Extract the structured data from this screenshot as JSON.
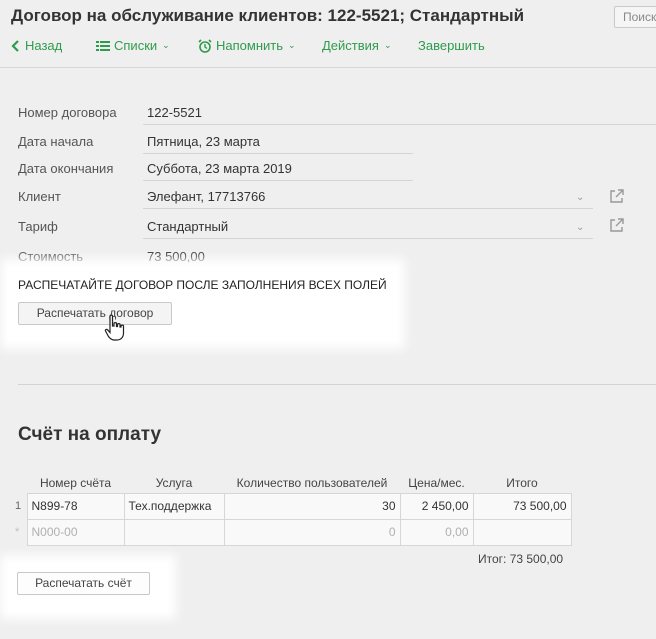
{
  "header": {
    "title": "Договор на обслуживание клиентов: 122-5521; Стандартный",
    "search_label": "Поиск"
  },
  "toolbar": {
    "back": "Назад",
    "lists": "Списки",
    "remind": "Напомнить",
    "actions": "Действия",
    "finish": "Завершить",
    "accent_color": "#2e9c4c"
  },
  "form": {
    "contract_number": {
      "label": "Номер договора",
      "value": "122-5521"
    },
    "start_date": {
      "label": "Дата начала",
      "value": "Пятница, 23 марта"
    },
    "end_date": {
      "label": "Дата окончания",
      "value": "Суббота, 23 марта 2019"
    },
    "client": {
      "label": "Клиент",
      "value": "Элефант, 17713766"
    },
    "tariff": {
      "label": "Тариф",
      "value": "Стандартный"
    },
    "cost": {
      "label": "Стоимость",
      "value": "73 500,00"
    }
  },
  "print_contract": {
    "notice": "РАСПЕЧАТАЙТЕ ДОГОВОР ПОСЛЕ ЗАПОЛНЕНИЯ ВСЕХ ПОЛЕЙ",
    "button": "Распечатать договор"
  },
  "invoice": {
    "title": "Счёт на оплату",
    "columns": [
      "Номер счёта",
      "Услуга",
      "Количество пользователей",
      "Цена/мес.",
      "Итого"
    ],
    "rows": [
      {
        "n": "1",
        "number": "N899-78",
        "service": "Тех.поддержка",
        "users": "30",
        "price": "2 450,00",
        "total": "73 500,00"
      },
      {
        "n": "*",
        "number": "N000-00",
        "service": "",
        "users": "0",
        "price": "0,00",
        "total": ""
      }
    ],
    "total_label": "Итог: 73 500,00",
    "print_button": "Распечатать счёт"
  }
}
